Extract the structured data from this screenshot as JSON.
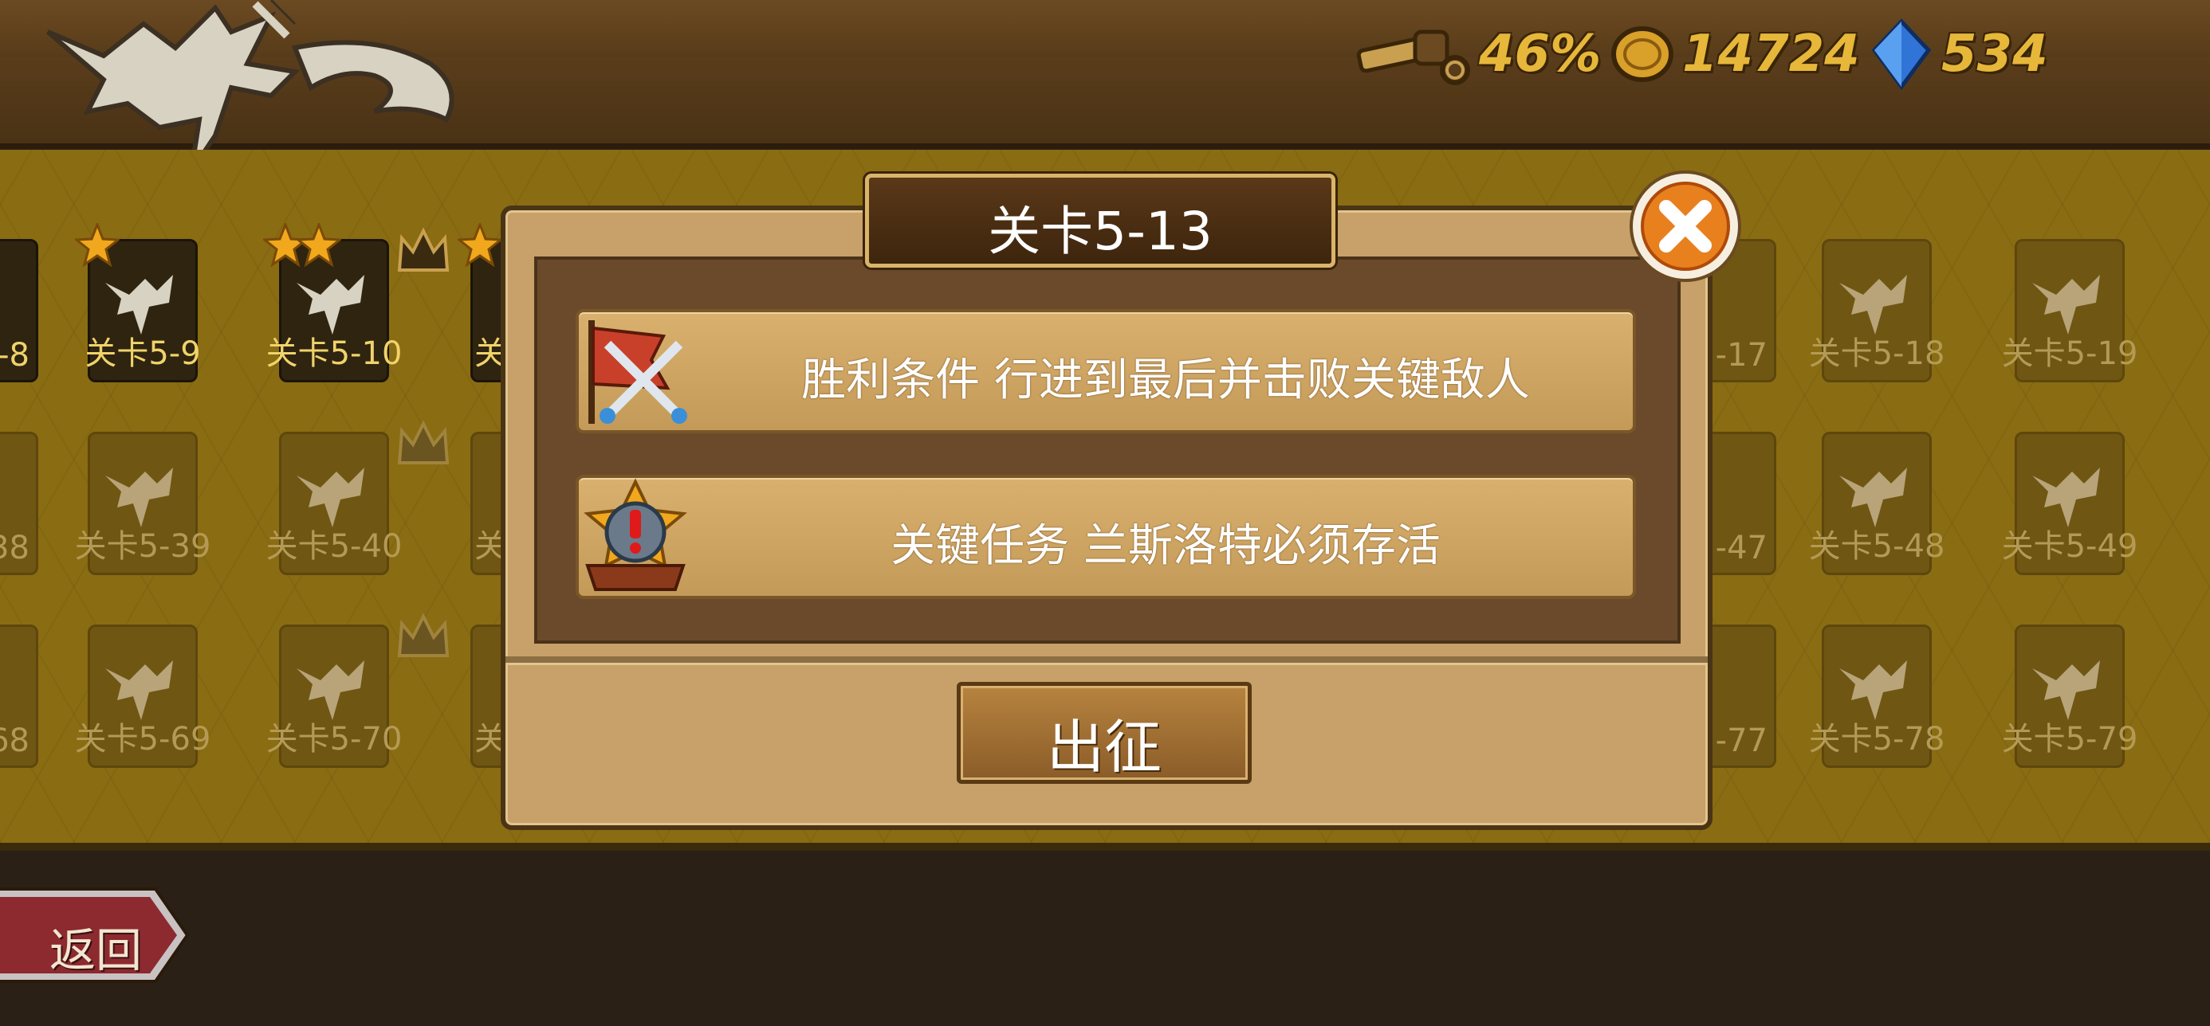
{
  "hud": {
    "telescope_value": "46%",
    "coins_value": "14724",
    "gems_value": "534"
  },
  "levels": {
    "row1": [
      "-8",
      "关卡5-9",
      "关卡5-10",
      "关",
      "-17",
      "关卡5-18",
      "关卡5-19"
    ],
    "row2": [
      "38",
      "关卡5-39",
      "关卡5-40",
      "关",
      "-47",
      "关卡5-48",
      "关卡5-49"
    ],
    "row3": [
      "68",
      "关卡5-69",
      "关卡5-70",
      "关",
      "-77",
      "关卡5-78",
      "关卡5-79"
    ]
  },
  "modal": {
    "title": "关卡5-13",
    "victory_text": "胜利条件 行进到最后并击败关键敌人",
    "mission_text": "关键任务 兰斯洛特必须存活",
    "go_label": "出征"
  },
  "back_label": "返回",
  "colors": {
    "accent_gold": "#e7b73a",
    "panel_tan": "#c7a169",
    "board_gold": "#8a6c12"
  }
}
